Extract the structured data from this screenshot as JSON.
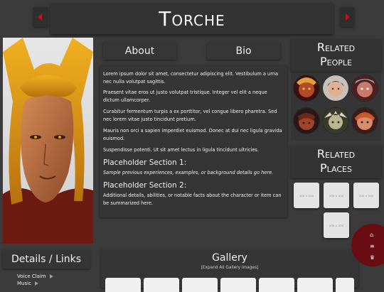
{
  "header": {
    "title": "Torche"
  },
  "tabs": {
    "about_label": "About",
    "bio_label": "Bio"
  },
  "bio": {
    "p1": "Lorem ipsum dolor sit amet, consectetur adipiscing elit. Vestibulum a urna nec nulla volutpat sagittis.",
    "p2": "Praesent vitae eros ut justo volutpat tristique. Integer vel elit a neque dictum ullamcorper.",
    "p3": "Curabitur fermentum turpis a ex porttitor, vel congue libero pharetra. Sed nec lorem vitae justo tincidunt pretium.",
    "p4": "Mauris non orci a sapien imperdiet euismod. Donec at dui nec ligula gravida euismod.",
    "p5": "Suspendisse potenti. Ut sit amet lectus in ligula tincidunt ultricies.",
    "section1_title": "Placeholder Section 1:",
    "section1_text": "Sample previous experiences, examples, or background details go here.",
    "section2_title": "Placeholder Section 2:",
    "section2_text": "Additional details, abilities, or notable facts about the character or item can be summarized here."
  },
  "related_people": {
    "heading_line1": "Related",
    "heading_line2": "People"
  },
  "related_places": {
    "heading_line1": "Related",
    "heading_line2": "Places",
    "placeholder_label": "200 × 200"
  },
  "details": {
    "heading": "Details / Links",
    "link1": "Voice Claim",
    "link2": "Music"
  },
  "gallery": {
    "title": "Gallery",
    "expand_label": "[Expand All Gallery Images]"
  },
  "colors": {
    "accent_red": "#c0141b",
    "panel": "#333333",
    "background": "#3b3b3b"
  },
  "icons": {
    "prev": "triangle-left-icon",
    "next": "triangle-right-icon",
    "home": "home-icon",
    "menu": "menu-icon",
    "crown": "crown-icon"
  }
}
